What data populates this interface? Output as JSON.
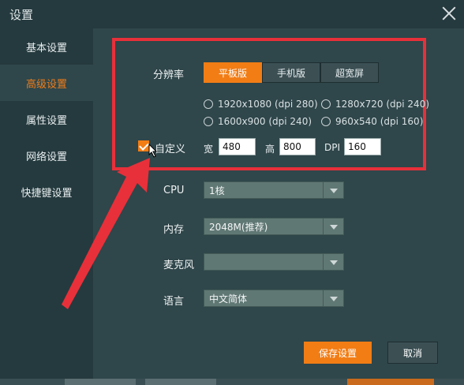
{
  "window": {
    "title": "设置"
  },
  "sidebar": {
    "items": [
      {
        "label": "基本设置",
        "active": false
      },
      {
        "label": "高级设置",
        "active": true
      },
      {
        "label": "属性设置",
        "active": false
      },
      {
        "label": "网络设置",
        "active": false
      },
      {
        "label": "快捷键设置",
        "active": false
      }
    ]
  },
  "resolution": {
    "label": "分辨率",
    "modes": [
      "平板版",
      "手机版",
      "超宽屏"
    ],
    "active_mode": "平板版",
    "options": [
      "1920x1080 (dpi 280)",
      "1280x720 (dpi 240)",
      "1600x900 (dpi 240)",
      "960x540 (dpi 160)"
    ]
  },
  "custom": {
    "label": "自定义",
    "checked": true,
    "width_label": "宽",
    "width": "480",
    "height_label": "高",
    "height": "800",
    "dpi_label": "DPI",
    "dpi": "160"
  },
  "cpu": {
    "label": "CPU",
    "value": "1核"
  },
  "memory": {
    "label": "内存",
    "value": "2048M(推荐)"
  },
  "mic": {
    "label": "麦克风",
    "value": ""
  },
  "language": {
    "label": "语言",
    "value": "中文简体"
  },
  "buttons": {
    "save": "保存设置",
    "cancel": "取消"
  },
  "colors": {
    "accent": "#f27d15",
    "highlight_box": "#e8303a",
    "arrow": "#e8303a"
  },
  "icons": [
    "close-icon",
    "chevron-down-icon",
    "checkmark-icon",
    "mouse-cursor-icon"
  ]
}
